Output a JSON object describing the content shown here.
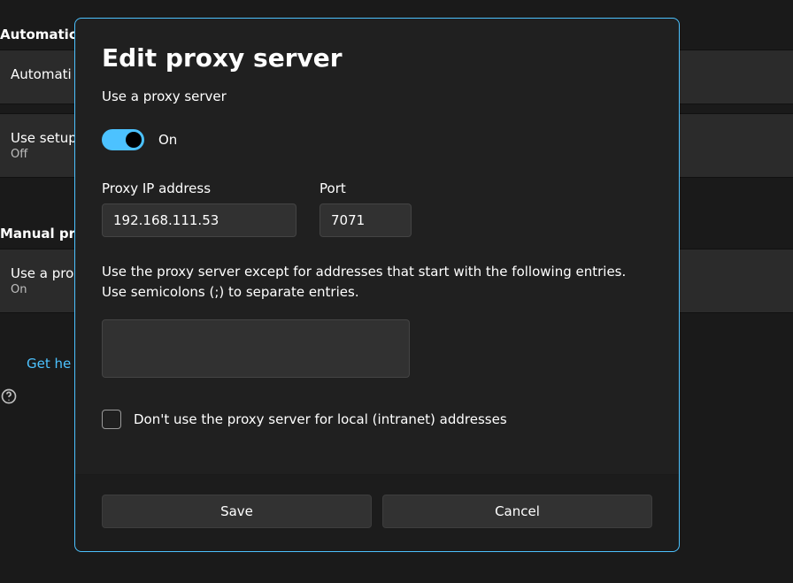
{
  "background": {
    "section_auto_title": "Automatic p",
    "row_auto_detect_label": "Automati",
    "row_setup_script_label": "Use setup",
    "row_setup_script_sub": "Off",
    "section_manual_title": "Manual pro",
    "row_use_proxy_label": "Use a pro",
    "row_use_proxy_sub": "On",
    "help_link": "Get he"
  },
  "modal": {
    "title": "Edit proxy server",
    "use_proxy_label": "Use a proxy server",
    "toggle_state_label": "On",
    "toggle_on": true,
    "ip_label": "Proxy IP address",
    "ip_value": "192.168.111.53",
    "port_label": "Port",
    "port_value": "7071",
    "exceptions_text": "Use the proxy server except for addresses that start with the following entries. Use semicolons (;) to separate entries.",
    "exceptions_value": "",
    "bypass_local_label": "Don't use the proxy server for local (intranet) addresses",
    "bypass_local_checked": false,
    "save_label": "Save",
    "cancel_label": "Cancel"
  }
}
